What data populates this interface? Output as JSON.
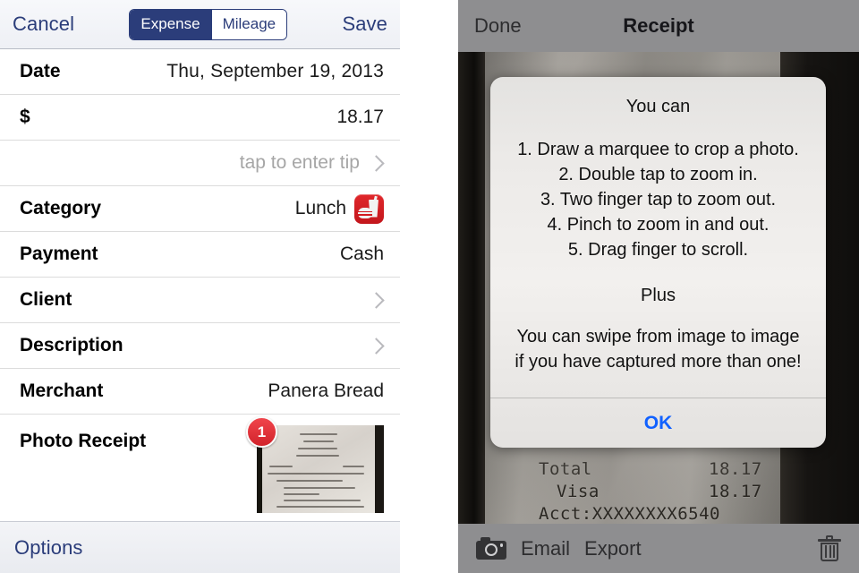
{
  "left_panel": {
    "nav": {
      "cancel_label": "Cancel",
      "save_label": "Save",
      "segments": [
        {
          "label": "Expense",
          "selected": true
        },
        {
          "label": "Mileage",
          "selected": false
        }
      ]
    },
    "rows": [
      {
        "label": "Date",
        "value": "Thu,  September 19, 2013"
      },
      {
        "label": "$",
        "value": "18.17"
      },
      {
        "label": "",
        "value": "tap to enter tip"
      },
      {
        "label": "Category",
        "value": "Lunch"
      },
      {
        "label": "Payment",
        "value": "Cash"
      },
      {
        "label": "Client",
        "value": ""
      },
      {
        "label": "Description",
        "value": ""
      },
      {
        "label": "Merchant",
        "value": "Panera Bread"
      },
      {
        "label": "Photo Receipt",
        "value": ""
      }
    ],
    "photo_badge_count": "1",
    "bottom": {
      "options_label": "Options"
    },
    "accent_color": "#2b3d7a",
    "category_icon_color": "#d2232b"
  },
  "right_panel": {
    "nav": {
      "done_label": "Done",
      "title": "Receipt"
    },
    "alert": {
      "heading": "You can",
      "steps": [
        "1. Draw a marquee to crop a photo.",
        "2. Double tap to zoom in.",
        "3. Two finger tap to zoom out.",
        "4. Pinch to zoom in and out.",
        "5. Drag finger to scroll."
      ],
      "sub_heading": "Plus",
      "note_line1": "You can swipe from image to image",
      "note_line2": "if you have captured more than one!",
      "ok_label": "OK",
      "ok_color": "#1161ff"
    },
    "photo_receipt_text": {
      "total_label": "Total",
      "total_value": "18.17",
      "visa_label": "Visa",
      "visa_value": "18.17",
      "account_line": "Acct:XXXXXXXX6540"
    },
    "toolbar": {
      "camera_icon": "camera-icon",
      "email_label": "Email",
      "export_label": "Export",
      "trash_icon": "trash-icon"
    }
  }
}
